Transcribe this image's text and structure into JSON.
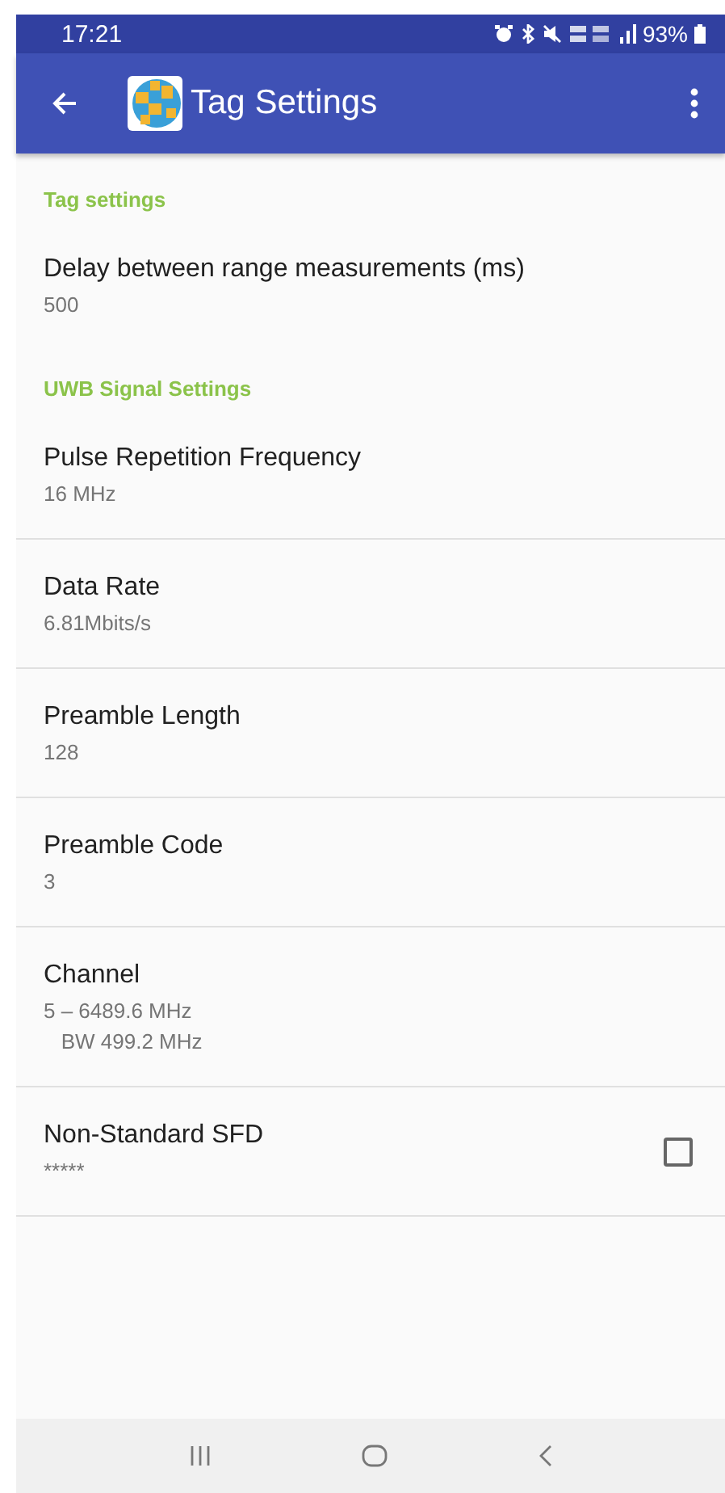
{
  "status_bar": {
    "time": "17:21",
    "battery": "93%"
  },
  "app_bar": {
    "title": "Tag Settings"
  },
  "sections": [
    {
      "header": "Tag settings",
      "items": [
        {
          "kind": "text",
          "title": "Delay between range measurements (ms)",
          "summary": [
            "500"
          ]
        }
      ]
    },
    {
      "header": "UWB Signal Settings",
      "items": [
        {
          "kind": "text",
          "title": "Pulse Repetition Frequency",
          "summary": [
            "16 MHz"
          ]
        },
        {
          "kind": "text",
          "title": "Data Rate",
          "summary": [
            "6.81Mbits/s"
          ]
        },
        {
          "kind": "text",
          "title": "Preamble Length",
          "summary": [
            "128"
          ]
        },
        {
          "kind": "text",
          "title": "Preamble Code",
          "summary": [
            "3"
          ]
        },
        {
          "kind": "text",
          "title": "Channel",
          "summary": [
            "5 – 6489.6 MHz",
            "   BW 499.2 MHz"
          ]
        },
        {
          "kind": "checkbox",
          "title": "Non-Standard SFD",
          "summary": [
            "*****"
          ],
          "checked": false
        }
      ]
    }
  ]
}
